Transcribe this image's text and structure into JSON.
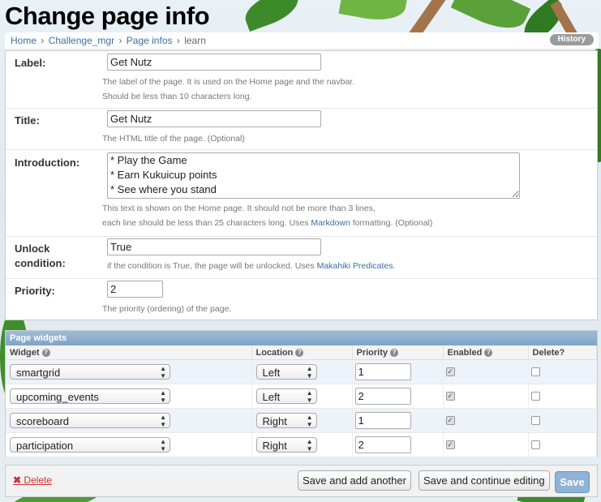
{
  "page": {
    "title": "Change page info"
  },
  "breadcrumb": {
    "home": "Home",
    "app": "Challenge_mgr",
    "model": "Page infos",
    "current": "learn",
    "sep": "›"
  },
  "history_label": "History",
  "fields": {
    "label": {
      "label": "Label:",
      "value": "Get Nutz",
      "help1": "The label of the page. It is used on the Home page and the navbar.",
      "help2": "Should be less than 10 characters long."
    },
    "title": {
      "label": "Title:",
      "value": "Get Nutz",
      "help1": "The HTML title of the page. (Optional)"
    },
    "introduction": {
      "label": "Introduction:",
      "value": "* Play the Game\n* Earn Kukuicup points\n* See where you stand",
      "help1": "This text is shown on the Home page. It should not be more than 3 lines,",
      "help2_pre": "each line should be less than 25 characters long. Uses ",
      "help2_link": "Markdown",
      "help2_post": " formatting. (Optional)"
    },
    "unlock": {
      "label_line1": "Unlock",
      "label_line2": "condition:",
      "value": "True",
      "help_pre": "if the condition is True, the page will be unlocked. Uses ",
      "help_link": "Makahiki Predicates",
      "help_post": "."
    },
    "priority": {
      "label": "Priority:",
      "value": "2",
      "help1": "The priority (ordering) of the page."
    }
  },
  "widgets": {
    "title": "Page widgets",
    "headers": {
      "widget": "Widget",
      "location": "Location",
      "priority": "Priority",
      "enabled": "Enabled",
      "delete": "Delete?"
    },
    "rows": [
      {
        "widget": "smartgrid",
        "location": "Left",
        "priority": "1",
        "enabled": true,
        "delete": false
      },
      {
        "widget": "upcoming_events",
        "location": "Left",
        "priority": "2",
        "enabled": true,
        "delete": false
      },
      {
        "widget": "scoreboard",
        "location": "Right",
        "priority": "1",
        "enabled": true,
        "delete": false
      },
      {
        "widget": "participation",
        "location": "Right",
        "priority": "2",
        "enabled": true,
        "delete": false
      }
    ]
  },
  "actions": {
    "delete": "Delete",
    "save_add": "Save and add another",
    "save_continue": "Save and continue editing",
    "save": "Save"
  },
  "colors": {
    "link": "#3a6ea5",
    "delete": "#cc3333",
    "inline_header": "#8fb0d2",
    "primary_button": "#8fb2d6"
  }
}
